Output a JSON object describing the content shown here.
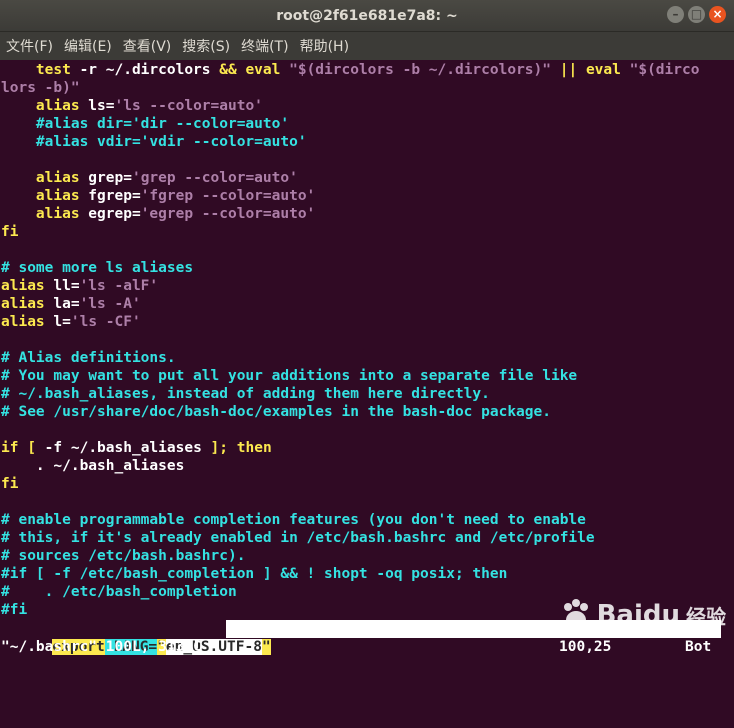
{
  "window": {
    "title": "root@2f61e681e7a8: ~"
  },
  "window_controls": {
    "minimize": "–",
    "maximize": "□",
    "close": "×"
  },
  "menu": [
    {
      "label": "文件(F)"
    },
    {
      "label": "编辑(E)"
    },
    {
      "label": "查看(V)"
    },
    {
      "label": "搜索(S)"
    },
    {
      "label": "终端(T)"
    },
    {
      "label": "帮助(H)"
    }
  ],
  "editor": {
    "lines": [
      [
        [
          "n",
          "    "
        ],
        [
          "k",
          "test"
        ],
        [
          "n",
          " -r ~/.dircolors "
        ],
        [
          "k",
          "&&"
        ],
        [
          "n",
          " "
        ],
        [
          "k",
          "eval"
        ],
        [
          "n",
          " "
        ],
        [
          "s",
          "\"$(dircolors -b ~/.dircolors)\""
        ],
        [
          "n",
          " "
        ],
        [
          "k",
          "||"
        ],
        [
          "n",
          " "
        ],
        [
          "k",
          "eval"
        ],
        [
          "n",
          " "
        ],
        [
          "s",
          "\"$(dirco"
        ]
      ],
      [
        [
          "s",
          "lors -b)\""
        ]
      ],
      [
        [
          "n",
          "    "
        ],
        [
          "k",
          "alias"
        ],
        [
          "n",
          " ls="
        ],
        [
          "s",
          "'ls --color=auto'"
        ]
      ],
      [
        [
          "n",
          "    "
        ],
        [
          "c",
          "#alias dir='dir --color=auto'"
        ]
      ],
      [
        [
          "n",
          "    "
        ],
        [
          "c",
          "#alias vdir='vdir --color=auto'"
        ]
      ],
      [
        [
          "n",
          ""
        ]
      ],
      [
        [
          "n",
          "    "
        ],
        [
          "k",
          "alias"
        ],
        [
          "n",
          " grep="
        ],
        [
          "s",
          "'grep --color=auto'"
        ]
      ],
      [
        [
          "n",
          "    "
        ],
        [
          "k",
          "alias"
        ],
        [
          "n",
          " fgrep="
        ],
        [
          "s",
          "'fgrep --color=auto'"
        ]
      ],
      [
        [
          "n",
          "    "
        ],
        [
          "k",
          "alias"
        ],
        [
          "n",
          " egrep="
        ],
        [
          "s",
          "'egrep --color=auto'"
        ]
      ],
      [
        [
          "k",
          "fi"
        ]
      ],
      [
        [
          "n",
          ""
        ]
      ],
      [
        [
          "c",
          "# some more ls aliases"
        ]
      ],
      [
        [
          "k",
          "alias"
        ],
        [
          "n",
          " ll="
        ],
        [
          "s",
          "'ls -alF'"
        ]
      ],
      [
        [
          "k",
          "alias"
        ],
        [
          "n",
          " la="
        ],
        [
          "s",
          "'ls -A'"
        ]
      ],
      [
        [
          "k",
          "alias"
        ],
        [
          "n",
          " l="
        ],
        [
          "s",
          "'ls -CF'"
        ]
      ],
      [
        [
          "n",
          ""
        ]
      ],
      [
        [
          "c",
          "# Alias definitions."
        ]
      ],
      [
        [
          "c",
          "# You may want to put all your additions into a separate file like"
        ]
      ],
      [
        [
          "c",
          "# ~/.bash_aliases, instead of adding them here directly."
        ]
      ],
      [
        [
          "c",
          "# See /usr/share/doc/bash-doc/examples in the bash-doc package."
        ]
      ],
      [
        [
          "n",
          ""
        ]
      ],
      [
        [
          "k",
          "if"
        ],
        [
          "n",
          " "
        ],
        [
          "k",
          "["
        ],
        [
          "n",
          " -f ~/.bash_aliases "
        ],
        [
          "k",
          "];"
        ],
        [
          "n",
          " "
        ],
        [
          "k",
          "then"
        ]
      ],
      [
        [
          "n",
          "    . ~/.bash_aliases"
        ]
      ],
      [
        [
          "k",
          "fi"
        ]
      ],
      [
        [
          "n",
          ""
        ]
      ],
      [
        [
          "c",
          "# enable programmable completion features (you don't need to enable"
        ]
      ],
      [
        [
          "c",
          "# this, if it's already enabled in /etc/bash.bashrc and /etc/profile"
        ]
      ],
      [
        [
          "c",
          "# sources /etc/bash.bashrc)."
        ]
      ],
      [
        [
          "c",
          "#if [ -f /etc/bash_completion ] && ! shopt -oq posix; then"
        ]
      ],
      [
        [
          "c",
          "#    . /etc/bash_completion"
        ]
      ],
      [
        [
          "c",
          "#fi"
        ]
      ]
    ],
    "export_line": [
      [
        "hl-yellow",
        "export"
      ],
      [
        "hl-cyan",
        " LANG="
      ],
      [
        "hl-yellow",
        "\""
      ],
      [
        "hl-white",
        "en_US.UTF-8"
      ],
      [
        "hl-yellow",
        "\""
      ]
    ]
  },
  "status": {
    "file_info": "\"~/.bashrc\" 100L, 3132C",
    "cursor_pos": "100,25",
    "scroll_pos": "Bot"
  },
  "watermark": {
    "brand": "Baidu",
    "suffix": "经验"
  }
}
